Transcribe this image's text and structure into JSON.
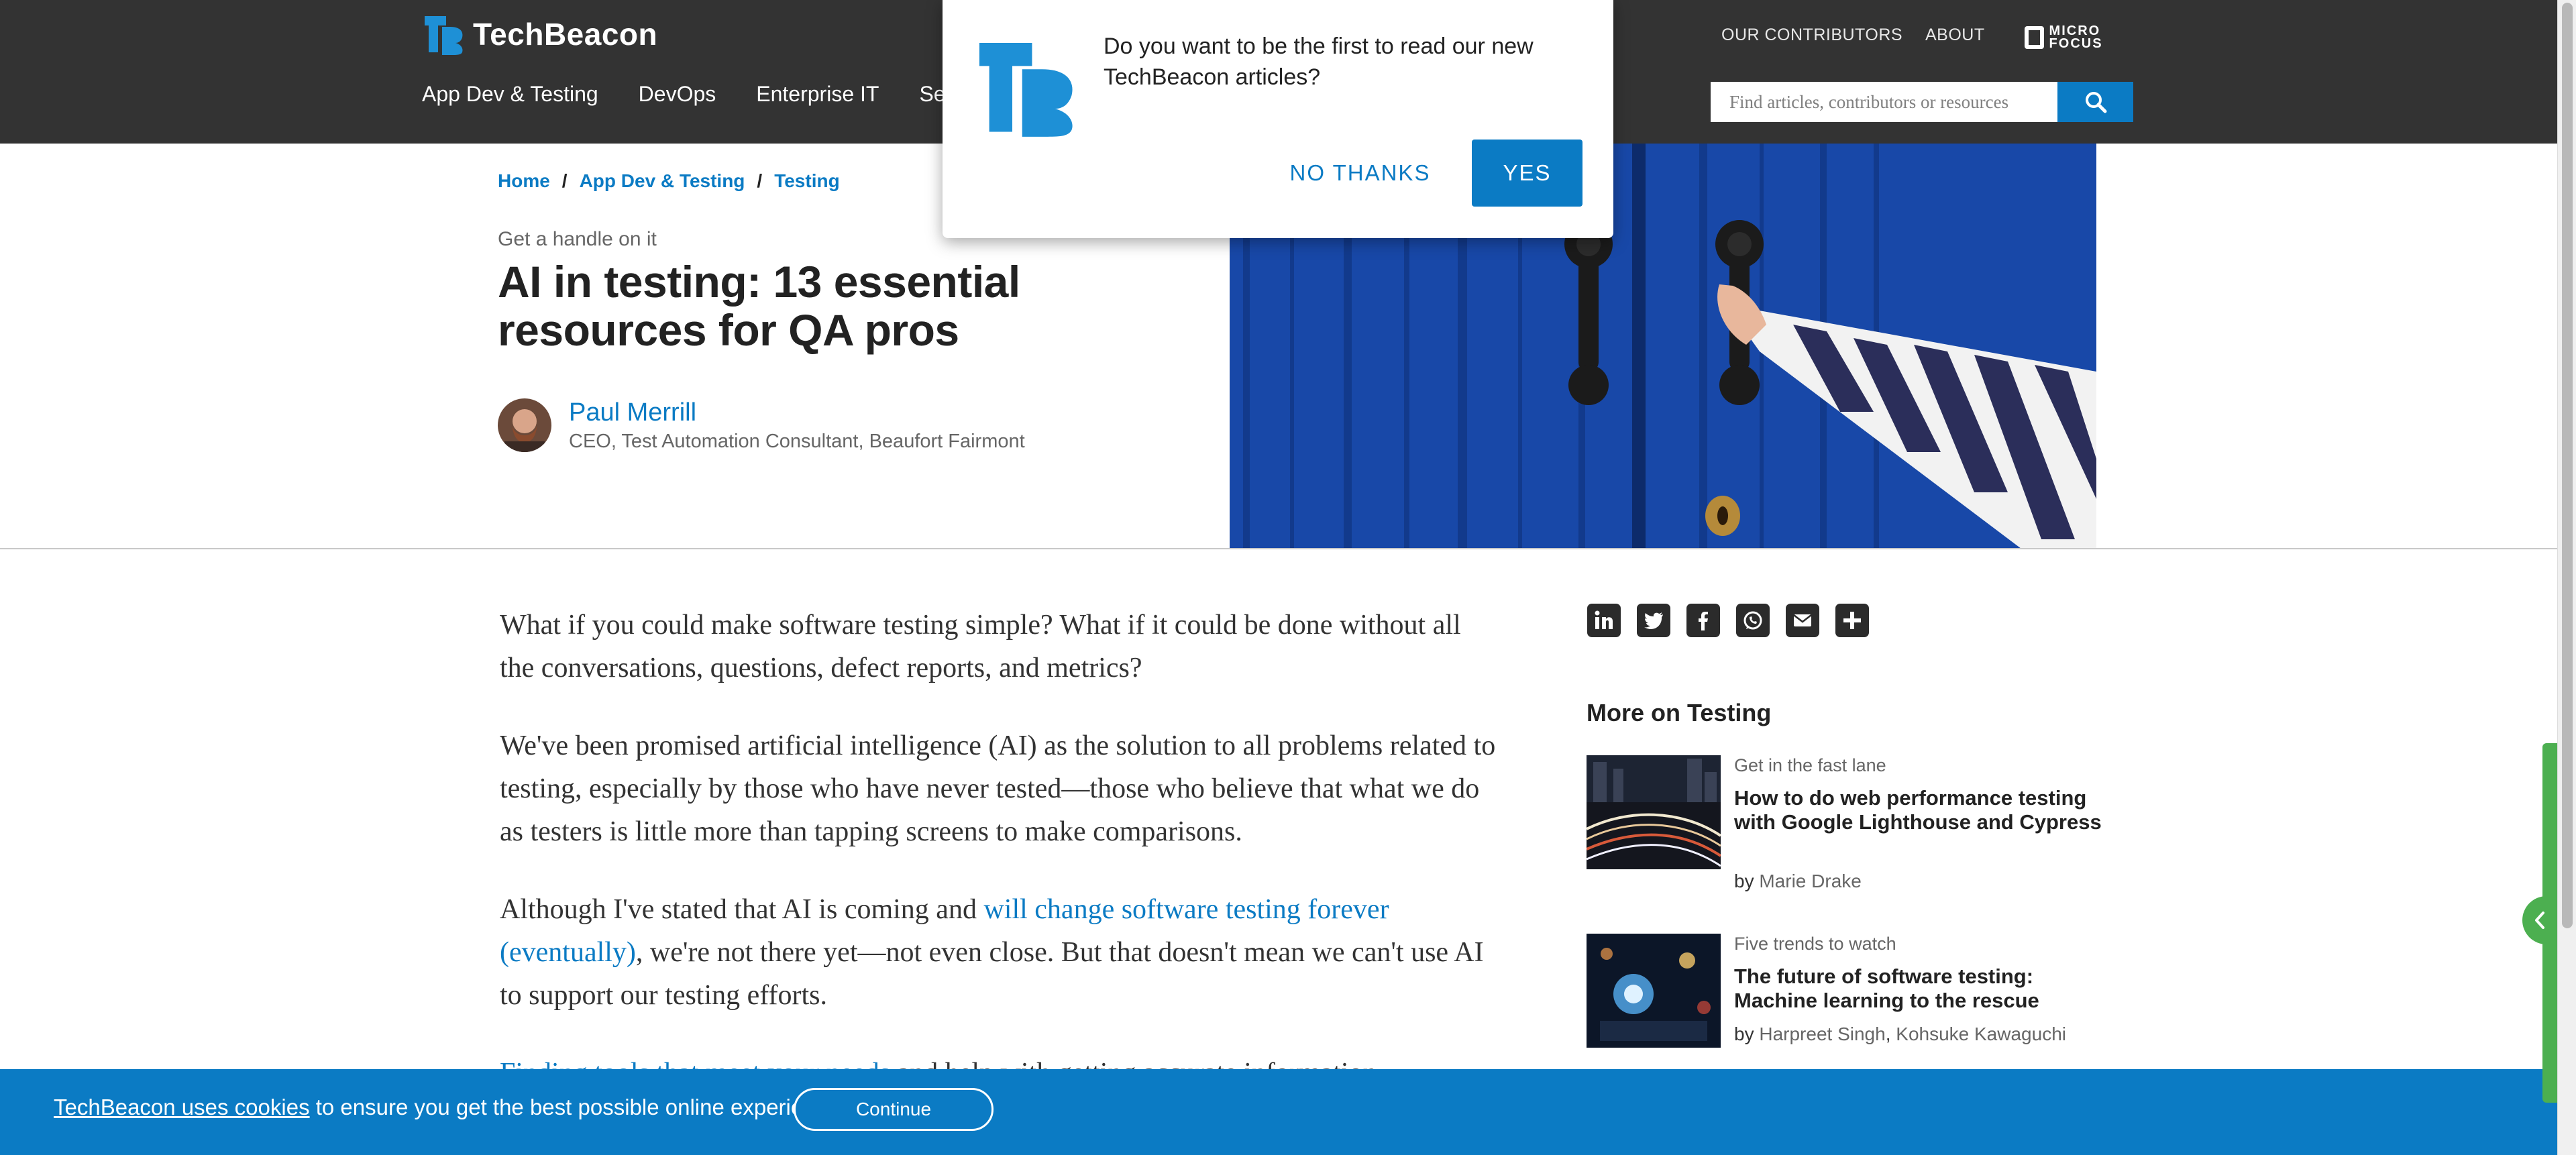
{
  "header": {
    "logo_text": "TechBeacon",
    "top_links": [
      "OUR CONTRIBUTORS",
      "ABOUT"
    ],
    "partner_logo_text": "MICRO FOCUS",
    "nav_items": [
      "App Dev & Testing",
      "DevOps",
      "Enterprise IT",
      "Sec"
    ],
    "search_placeholder": "Find articles, contributors or resources"
  },
  "breadcrumb": [
    "Home",
    "App Dev & Testing",
    "Testing"
  ],
  "article": {
    "kicker": "Get a handle on it",
    "title": "AI in testing: 13 essential resources for QA pros",
    "author_name": "Paul Merrill",
    "author_title": "CEO, Test Automation Consultant, Beaufort Fairmont",
    "paragraphs": {
      "p1": "What if you could make software testing simple? What if it could be done without all the conversations, questions, defect reports, and metrics?",
      "p2": "We've been promised artificial intelligence (AI) as the solution to all problems related to testing, especially by those who have never tested—those who believe that what we do as testers is little more than tapping screens to make comparisons.",
      "p3_before": "Although I've stated that AI is coming and ",
      "p3_link": "will change software testing forever (eventually)",
      "p3_after": ", we're not there yet—not even close. But that doesn't mean we can't use AI to support our testing efforts.",
      "p4_link": "Finding tools that meet your needs",
      "p4_after": " and help with getting accurate information"
    }
  },
  "share": {
    "icons": [
      "linkedin-icon",
      "twitter-icon",
      "facebook-icon",
      "whatsapp-icon",
      "email-icon",
      "plus-icon"
    ]
  },
  "sidebar": {
    "heading": "More on Testing",
    "by_label": "by",
    "cards": [
      {
        "kicker": "Get in the fast lane",
        "title": "How to do web performance testing with Google Lighthouse and Cypress",
        "authors": [
          "Marie Drake"
        ]
      },
      {
        "kicker": "Five trends to watch",
        "title": "The future of software testing: Machine learning to the rescue",
        "authors": [
          "Harpreet Singh",
          "Kohsuke Kawaguchi"
        ]
      }
    ]
  },
  "popup": {
    "message": "Do you want to be the first to read our new TechBeacon articles?",
    "no_label": "NO THANKS",
    "yes_label": "YES"
  },
  "cookie": {
    "link_text": "TechBeacon uses cookies",
    "message": " to ensure you get the best possible online experience.",
    "continue_label": "Continue"
  },
  "colors": {
    "accent": "#0b7bc4",
    "header_bg": "#333333",
    "progress": "#4caf50"
  }
}
